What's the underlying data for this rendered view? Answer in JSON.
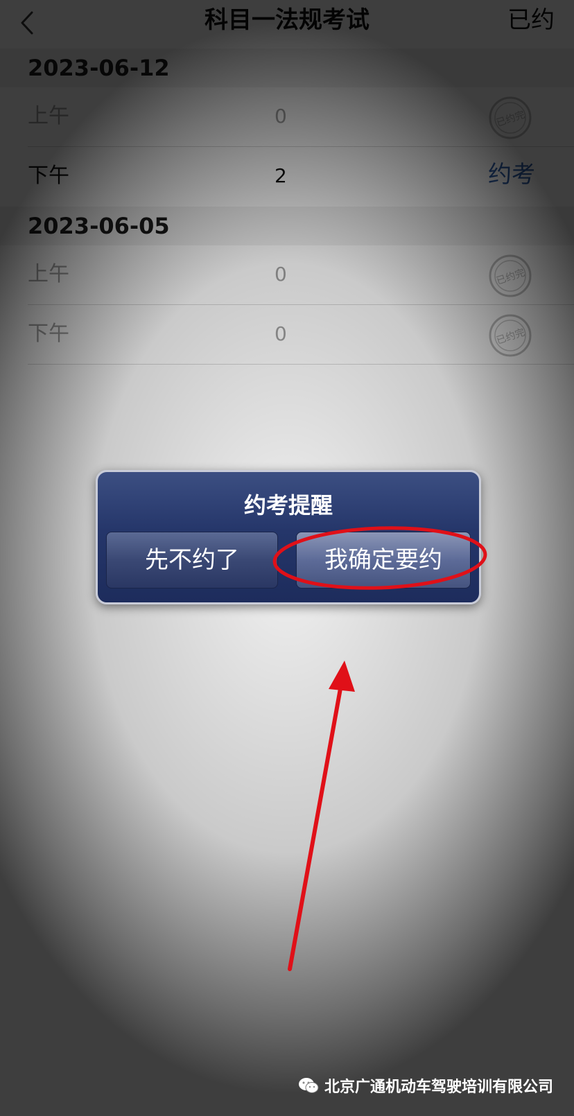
{
  "nav": {
    "title": "科目一法规考试",
    "right_label": "已约"
  },
  "sessions": [
    {
      "date": "2023-06-12",
      "slots": [
        {
          "label": "上午",
          "count": "0",
          "status": "已约完"
        },
        {
          "label": "下午",
          "count": "2",
          "action": "约考"
        }
      ]
    },
    {
      "date": "2023-06-05",
      "slots": [
        {
          "label": "上午",
          "count": "0",
          "status": "已约完"
        },
        {
          "label": "下午",
          "count": "0",
          "status": "已约完"
        }
      ]
    }
  ],
  "dialog": {
    "title": "约考提醒",
    "cancel_label": "先不约了",
    "confirm_label": "我确定要约"
  },
  "watermark": {
    "text": "北京广通机动车驾驶培训有限公司"
  },
  "colors": {
    "link_blue": "#2d5aa0",
    "dialog_navy": "#25366a",
    "annotation_red": "#e01018"
  },
  "icons": {
    "back": "chevron-left-icon",
    "stamp": "stamp-icon",
    "watermark": "wechat-icon"
  }
}
